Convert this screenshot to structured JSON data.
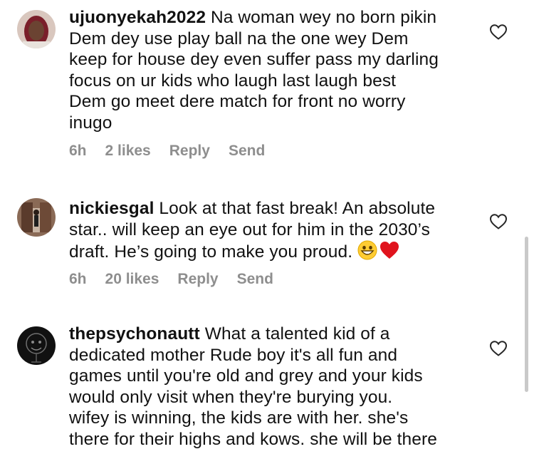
{
  "comments": [
    {
      "username": "ujuonyekah2022",
      "lines": [
        " Na woman wey no born pikin",
        "Dem dey use play ball  na the one wey Dem",
        "keep for house dey even suffer pass my darling",
        "focus on ur kids who laugh last laugh best",
        "Dem go meet dere match for front no worry",
        "inugo"
      ],
      "time": "6h",
      "likes": "2 likes",
      "reply": "Reply",
      "send": "Send"
    },
    {
      "username": "nickiesgal",
      "lines": [
        " Look at that fast break! An absolute",
        "star.. will keep an eye out for him in the 2030’s",
        "draft. He’s going to make you proud. "
      ],
      "time": "6h",
      "likes": "20 likes",
      "reply": "Reply",
      "send": "Send"
    },
    {
      "username": "thepsychonautt",
      "lines": [
        " What a talented kid of a",
        "dedicated mother  Rude boy it's all fun and",
        "games until you're old and grey and your kids",
        "would only visit when they're burying you.",
        "wifey is winning, the kids are with her. she's",
        "there for their highs and kows. she will be there"
      ]
    }
  ],
  "icons": {
    "like": "heart-outline-icon",
    "grin": "grinning-face-emoji",
    "red_heart": "red-heart-emoji"
  },
  "colors": {
    "text": "#111111",
    "meta": "#8e8e8e",
    "heart_stroke": "#262626",
    "emoji_heart": "#e0131d"
  }
}
